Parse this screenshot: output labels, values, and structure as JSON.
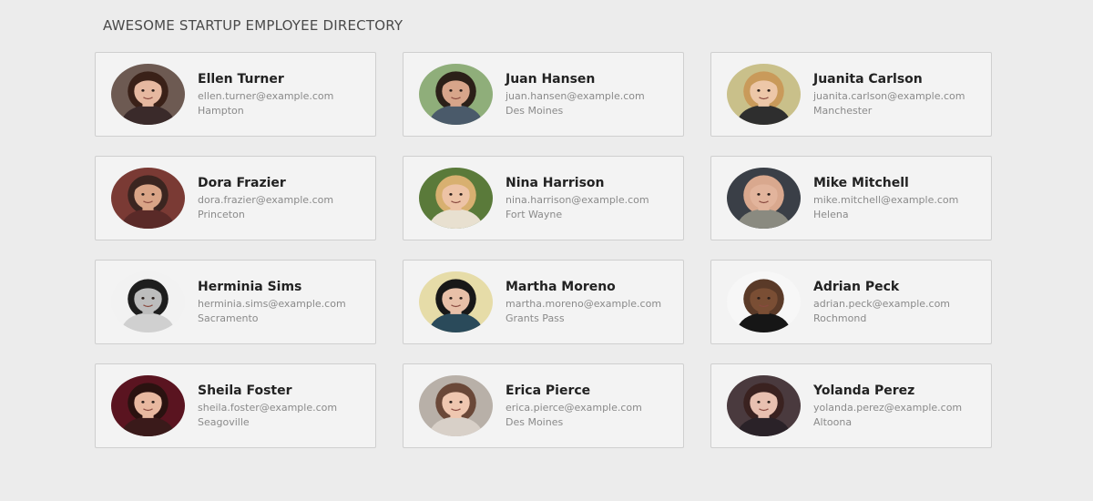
{
  "header": {
    "title": "AWESOME STARTUP EMPLOYEE DIRECTORY"
  },
  "employees": [
    {
      "name": "Ellen Turner",
      "email": "ellen.turner@example.com",
      "city": "Hampton",
      "avatar": {
        "bg": "#6d5a52",
        "skin": "#e6b8a0",
        "hair": "#3a2118",
        "shirt": "#3a2a2a"
      }
    },
    {
      "name": "Juan Hansen",
      "email": "juan.hansen@example.com",
      "city": "Des Moines",
      "avatar": {
        "bg": "#8fae7a",
        "skin": "#d7a58a",
        "hair": "#2b2018",
        "shirt": "#4a5a6a"
      }
    },
    {
      "name": "Juanita Carlson",
      "email": "juanita.carlson@example.com",
      "city": "Manchester",
      "avatar": {
        "bg": "#c9c08a",
        "skin": "#edc7a8",
        "hair": "#c99a5a",
        "shirt": "#2e2e2e"
      }
    },
    {
      "name": "Dora Frazier",
      "email": "dora.frazier@example.com",
      "city": "Princeton",
      "avatar": {
        "bg": "#7a3a34",
        "skin": "#d9a486",
        "hair": "#3b2520",
        "shirt": "#5a2a28"
      }
    },
    {
      "name": "Nina Harrison",
      "email": "nina.harrison@example.com",
      "city": "Fort Wayne",
      "avatar": {
        "bg": "#5a7a3a",
        "skin": "#edc3a6",
        "hair": "#d8b070",
        "shirt": "#e8e0d0"
      }
    },
    {
      "name": "Mike Mitchell",
      "email": "mike.mitchell@example.com",
      "city": "Helena",
      "avatar": {
        "bg": "#3a3f47",
        "skin": "#e2b49c",
        "hair": "#d9a88e",
        "shirt": "#8a8a80"
      }
    },
    {
      "name": "Herminia Sims",
      "email": "herminia.sims@example.com",
      "city": "Sacramento",
      "avatar": {
        "bg": "#f2f2f2",
        "skin": "#bdbdbd",
        "hair": "#1e1e1e",
        "shirt": "#d0d0d0"
      }
    },
    {
      "name": "Martha Moreno",
      "email": "martha.moreno@example.com",
      "city": "Grants Pass",
      "avatar": {
        "bg": "#e6dca8",
        "skin": "#e8c0a8",
        "hair": "#181818",
        "shirt": "#2a4a5a"
      }
    },
    {
      "name": "Adrian Peck",
      "email": "adrian.peck@example.com",
      "city": "Rochmond",
      "avatar": {
        "bg": "#f7f7f7",
        "skin": "#7a4e34",
        "hair": "#5a3a28",
        "shirt": "#161616"
      }
    },
    {
      "name": "Sheila Foster",
      "email": "sheila.foster@example.com",
      "city": "Seagoville",
      "avatar": {
        "bg": "#5a1420",
        "skin": "#e8b8a0",
        "hair": "#2a1210",
        "shirt": "#3a1a1a"
      }
    },
    {
      "name": "Erica Pierce",
      "email": "erica.pierce@example.com",
      "city": "Des Moines",
      "avatar": {
        "bg": "#b8b0a8",
        "skin": "#efc7b0",
        "hair": "#6a4838",
        "shirt": "#d8d0c8"
      }
    },
    {
      "name": "Yolanda Perez",
      "email": "yolanda.perez@example.com",
      "city": "Altoona",
      "avatar": {
        "bg": "#4a3a3e",
        "skin": "#e8c0b0",
        "hair": "#3a2220",
        "shirt": "#2a2228"
      }
    }
  ]
}
